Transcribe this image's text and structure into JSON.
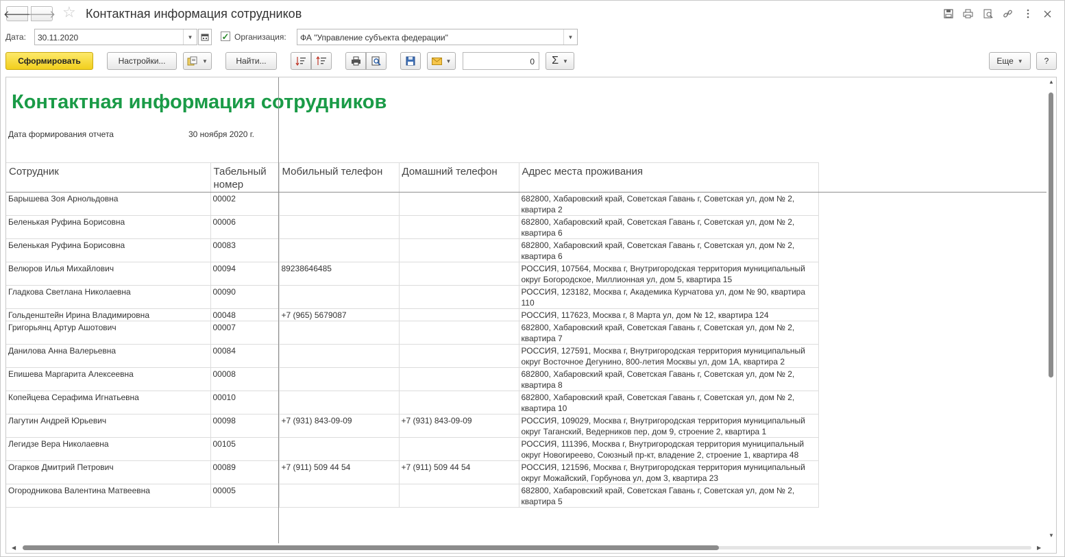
{
  "window": {
    "title": "Контактная информация сотрудников"
  },
  "params": {
    "date_label": "Дата:",
    "date_value": "30.11.2020",
    "org_checked": true,
    "org_label": "Организация:",
    "org_value": "ФА \"Управление субъекта федерации\""
  },
  "toolbar": {
    "generate_label": "Сформировать",
    "settings_label": "Настройки...",
    "find_label": "Найти...",
    "number_value": "0",
    "more_label": "Еще",
    "help_label": "?"
  },
  "report": {
    "title": "Контактная информация сотрудников",
    "date_label": "Дата формирования отчета",
    "date_value": "30 ноября 2020 г.",
    "columns": [
      "Сотрудник",
      "Табельный номер",
      "Мобильный телефон",
      "Домашний телефон",
      "Адрес места проживания"
    ],
    "rows": [
      {
        "name": "Барышева Зоя Арнольдовна",
        "num": "00002",
        "mobile": "",
        "home": "",
        "address": "682800, Хабаровский край, Советская Гавань г, Советская ул, дом № 2, квартира 2"
      },
      {
        "name": "Беленькая Руфина Борисовна",
        "num": "00006",
        "mobile": "",
        "home": "",
        "address": "682800, Хабаровский край, Советская Гавань г, Советская ул, дом № 2, квартира 6"
      },
      {
        "name": "Беленькая Руфина Борисовна",
        "num": "00083",
        "mobile": "",
        "home": "",
        "address": "682800, Хабаровский край, Советская Гавань г, Советская ул, дом № 2, квартира 6"
      },
      {
        "name": "Велюров Илья Михайлович",
        "num": "00094",
        "mobile": "89238646485",
        "home": "",
        "address": "РОССИЯ, 107564, Москва г, Внутригородская территория муниципальный округ Богородское, Миллионная ул, дом 5, квартира 15"
      },
      {
        "name": "Гладкова Светлана Николаевна",
        "num": "00090",
        "mobile": "",
        "home": "",
        "address": "РОССИЯ, 123182, Москва г, Академика Курчатова ул, дом № 90, квартира 110"
      },
      {
        "name": "Гольденштейн Ирина Владимировна",
        "num": "00048",
        "mobile": "+7 (965) 5679087",
        "home": "",
        "address": "РОССИЯ, 117623, Москва г, 8 Марта ул, дом № 12, квартира 124"
      },
      {
        "name": "Григорьянц Артур Ашотович",
        "num": "00007",
        "mobile": "",
        "home": "",
        "address": "682800, Хабаровский край, Советская Гавань г, Советская ул, дом № 2, квартира 7"
      },
      {
        "name": "Данилова Анна Валерьевна",
        "num": "00084",
        "mobile": "",
        "home": "",
        "address": "РОССИЯ, 127591, Москва г, Внутригородская территория муниципальный округ Восточное Дегунино, 800-летия Москвы ул, дом 1А, квартира 2"
      },
      {
        "name": "Епишева Маргарита Алексеевна",
        "num": "00008",
        "mobile": "",
        "home": "",
        "address": "682800, Хабаровский край, Советская Гавань г, Советская ул, дом № 2, квартира 8"
      },
      {
        "name": "Копейцева Серафима Игнатьевна",
        "num": "00010",
        "mobile": "",
        "home": "",
        "address": "682800, Хабаровский край, Советская Гавань г, Советская ул, дом № 2, квартира 10"
      },
      {
        "name": "Лагутин Андрей Юрьевич",
        "num": "00098",
        "mobile": "+7 (931) 843-09-09",
        "home": "+7 (931) 843-09-09",
        "address": "РОССИЯ, 109029, Москва г, Внутригородская территория муниципальный округ Таганский, Ведерников пер, дом 9, строение 2, квартира 1"
      },
      {
        "name": "Легидзе Вера Николаевна",
        "num": "00105",
        "mobile": "",
        "home": "",
        "address": "РОССИЯ, 111396, Москва г, Внутригородская территория муниципальный округ Новогиреево, Союзный пр-кт, владение 2, строение 1, квартира 48"
      },
      {
        "name": "Огарков Дмитрий Петрович",
        "num": "00089",
        "mobile": "+7 (911) 509 44 54",
        "home": "+7 (911) 509 44 54",
        "address": "РОССИЯ, 121596, Москва г, Внутригородская территория муниципальный округ Можайский, Горбунова ул, дом 3, квартира 23"
      },
      {
        "name": "Огородникова Валентина Матвеевна",
        "num": "00005",
        "mobile": "",
        "home": "",
        "address": "682800, Хабаровский край, Советская Гавань г, Советская ул, дом № 2, квартира 5"
      }
    ]
  },
  "icons": {
    "back": "arrow-left-icon",
    "forward": "arrow-right-icon",
    "favorite": "star-icon",
    "header_actions": [
      "save-icon",
      "print-icon",
      "preview-icon",
      "link-icon",
      "more-vertical-icon",
      "close-icon"
    ]
  },
  "colors": {
    "report_title": "#1a9b47",
    "primary_button": "#f2cf1d",
    "checkbox_mark": "#2e8b2e"
  }
}
